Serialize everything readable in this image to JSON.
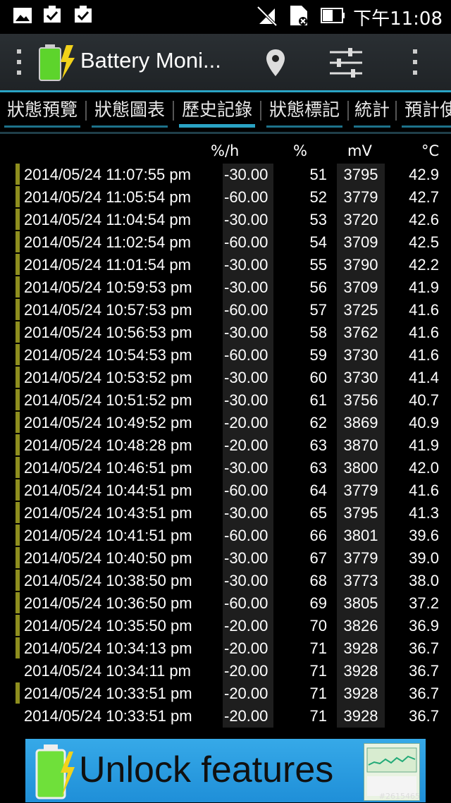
{
  "status_bar": {
    "time": "下午11:08",
    "icons": [
      "gallery-icon",
      "checkbox-icon",
      "checkbox-icon",
      "mute-icon",
      "sim-card-icon",
      "battery-icon"
    ]
  },
  "action_bar": {
    "title": "Battery Moni...",
    "icons": [
      "app-battery-icon",
      "location-pin-icon",
      "sliders-icon",
      "overflow-menu-icon"
    ]
  },
  "tabs": [
    "狀態預覽",
    "狀態圖表",
    "歷史記錄",
    "狀態標記",
    "統計",
    "預計使"
  ],
  "active_tab": 2,
  "table": {
    "headers": {
      "rate": "%/h",
      "percent": "%",
      "mv": "mV",
      "temp": "°C"
    },
    "rows": [
      {
        "date": "2014/05/24  11:07:55 pm",
        "rate": "-30.00",
        "pct": "51",
        "mv": "3795",
        "temp": "42.9",
        "marked": true
      },
      {
        "date": "2014/05/24  11:05:54 pm",
        "rate": "-60.00",
        "pct": "52",
        "mv": "3779",
        "temp": "42.7",
        "marked": true
      },
      {
        "date": "2014/05/24  11:04:54 pm",
        "rate": "-30.00",
        "pct": "53",
        "mv": "3720",
        "temp": "42.6",
        "marked": true
      },
      {
        "date": "2014/05/24  11:02:54 pm",
        "rate": "-60.00",
        "pct": "54",
        "mv": "3709",
        "temp": "42.5",
        "marked": true
      },
      {
        "date": "2014/05/24  11:01:54 pm",
        "rate": "-30.00",
        "pct": "55",
        "mv": "3790",
        "temp": "42.2",
        "marked": true
      },
      {
        "date": "2014/05/24  10:59:53 pm",
        "rate": "-30.00",
        "pct": "56",
        "mv": "3709",
        "temp": "41.9",
        "marked": true
      },
      {
        "date": "2014/05/24  10:57:53 pm",
        "rate": "-60.00",
        "pct": "57",
        "mv": "3725",
        "temp": "41.6",
        "marked": true
      },
      {
        "date": "2014/05/24  10:56:53 pm",
        "rate": "-30.00",
        "pct": "58",
        "mv": "3762",
        "temp": "41.6",
        "marked": true
      },
      {
        "date": "2014/05/24  10:54:53 pm",
        "rate": "-60.00",
        "pct": "59",
        "mv": "3730",
        "temp": "41.6",
        "marked": true
      },
      {
        "date": "2014/05/24  10:53:52 pm",
        "rate": "-30.00",
        "pct": "60",
        "mv": "3730",
        "temp": "41.4",
        "marked": true
      },
      {
        "date": "2014/05/24  10:51:52 pm",
        "rate": "-30.00",
        "pct": "61",
        "mv": "3756",
        "temp": "40.7",
        "marked": true
      },
      {
        "date": "2014/05/24  10:49:52 pm",
        "rate": "-20.00",
        "pct": "62",
        "mv": "3869",
        "temp": "40.9",
        "marked": true
      },
      {
        "date": "2014/05/24  10:48:28 pm",
        "rate": "-20.00",
        "pct": "63",
        "mv": "3870",
        "temp": "41.9",
        "marked": true
      },
      {
        "date": "2014/05/24  10:46:51 pm",
        "rate": "-30.00",
        "pct": "63",
        "mv": "3800",
        "temp": "42.0",
        "marked": true
      },
      {
        "date": "2014/05/24  10:44:51 pm",
        "rate": "-60.00",
        "pct": "64",
        "mv": "3779",
        "temp": "41.6",
        "marked": true
      },
      {
        "date": "2014/05/24  10:43:51 pm",
        "rate": "-30.00",
        "pct": "65",
        "mv": "3795",
        "temp": "41.3",
        "marked": true
      },
      {
        "date": "2014/05/24  10:41:51 pm",
        "rate": "-60.00",
        "pct": "66",
        "mv": "3801",
        "temp": "39.6",
        "marked": true
      },
      {
        "date": "2014/05/24  10:40:50 pm",
        "rate": "-30.00",
        "pct": "67",
        "mv": "3779",
        "temp": "39.0",
        "marked": true
      },
      {
        "date": "2014/05/24  10:38:50 pm",
        "rate": "-30.00",
        "pct": "68",
        "mv": "3773",
        "temp": "38.0",
        "marked": true
      },
      {
        "date": "2014/05/24  10:36:50 pm",
        "rate": "-60.00",
        "pct": "69",
        "mv": "3805",
        "temp": "37.2",
        "marked": true
      },
      {
        "date": "2014/05/24  10:35:50 pm",
        "rate": "-20.00",
        "pct": "70",
        "mv": "3826",
        "temp": "36.9",
        "marked": true
      },
      {
        "date": "2014/05/24  10:34:13 pm",
        "rate": "-20.00",
        "pct": "71",
        "mv": "3928",
        "temp": "36.7",
        "marked": true
      },
      {
        "date": "2014/05/24  10:34:11 pm",
        "rate": "-20.00",
        "pct": "71",
        "mv": "3928",
        "temp": "36.7",
        "marked": false
      },
      {
        "date": "2014/05/24  10:33:51 pm",
        "rate": "-20.00",
        "pct": "71",
        "mv": "3928",
        "temp": "36.7",
        "marked": true
      },
      {
        "date": "2014/05/24  10:33:51 pm",
        "rate": "-20.00",
        "pct": "71",
        "mv": "3928",
        "temp": "36.7",
        "marked": false
      }
    ]
  },
  "ad": {
    "text": "Unlock features",
    "tag": "#2615465"
  },
  "colors": {
    "accent": "#2aa3c4",
    "marker": "#8e8e1e",
    "cell_bg": "#1e1e1e",
    "ad_bg": "#36a9e8"
  }
}
